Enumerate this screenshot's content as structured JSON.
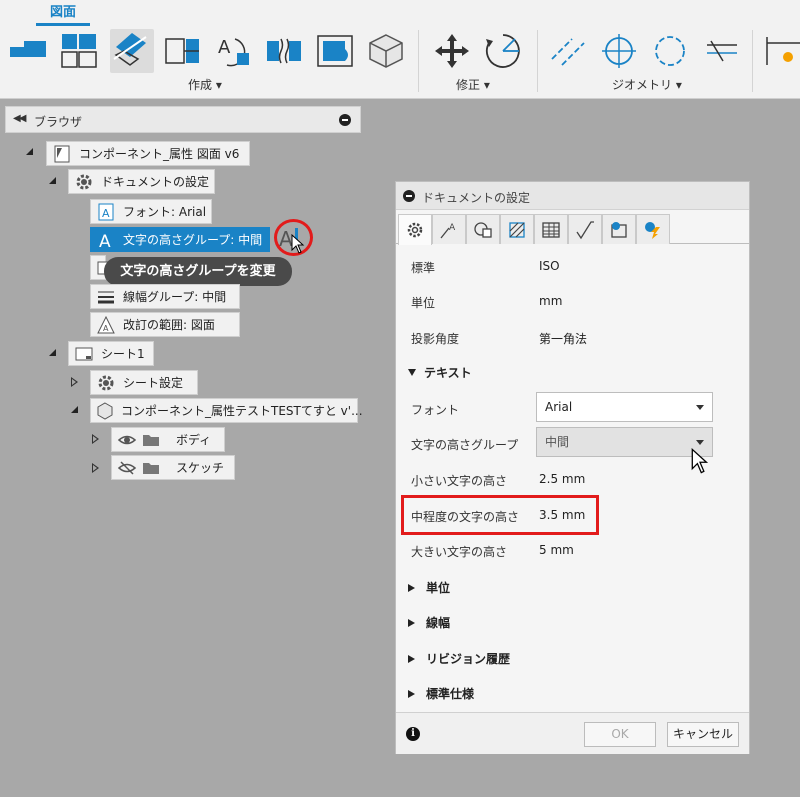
{
  "ribbon": {
    "active_tab": "図面",
    "groups": {
      "create": "作成 ▾",
      "modify": "修正 ▾",
      "geometry": "ジオメトリ ▾"
    }
  },
  "browser": {
    "title": "ブラウザ",
    "nodes": {
      "root": "コンポーネント_属性 図面 v6",
      "doc_settings": "ドキュメントの設定",
      "font": "フォント: Arial",
      "text_height_group": "文字の高さグループ: 中間",
      "line_width_group": "線幅グループ: 中間",
      "revision_range": "改訂の範囲: 図面",
      "sheet1": "シート1",
      "sheet_settings": "シート設定",
      "component_view": "コンポーネント_属性テストTESTてすと v'...",
      "bodies": "ボディ",
      "sketches": "スケッチ"
    },
    "tooltip": "文字の高さグループを変更"
  },
  "dialog": {
    "title": "ドキュメントの設定",
    "standard": {
      "label": "標準",
      "value": "ISO"
    },
    "units": {
      "label": "単位",
      "value": "mm"
    },
    "projection": {
      "label": "投影角度",
      "value": "第一角法"
    },
    "section_text": "テキスト",
    "font": {
      "label": "フォント",
      "value": "Arial"
    },
    "text_height_group": {
      "label": "文字の高さグループ",
      "value": "中間"
    },
    "small_text": {
      "label": "小さい文字の高さ",
      "value": "2.5 mm"
    },
    "medium_text": {
      "label": "中程度の文字の高さ",
      "value": "3.5 mm"
    },
    "large_text": {
      "label": "大きい文字の高さ",
      "value": "5 mm"
    },
    "sections": {
      "units": "単位",
      "line_width": "線幅",
      "revision_history": "リビジョン履歴",
      "standard_spec": "標準仕様"
    },
    "ok_label": "OK",
    "cancel_label": "キャンセル"
  },
  "colors": {
    "accent": "#1a83c6",
    "highlight_red": "#e21b1b"
  }
}
